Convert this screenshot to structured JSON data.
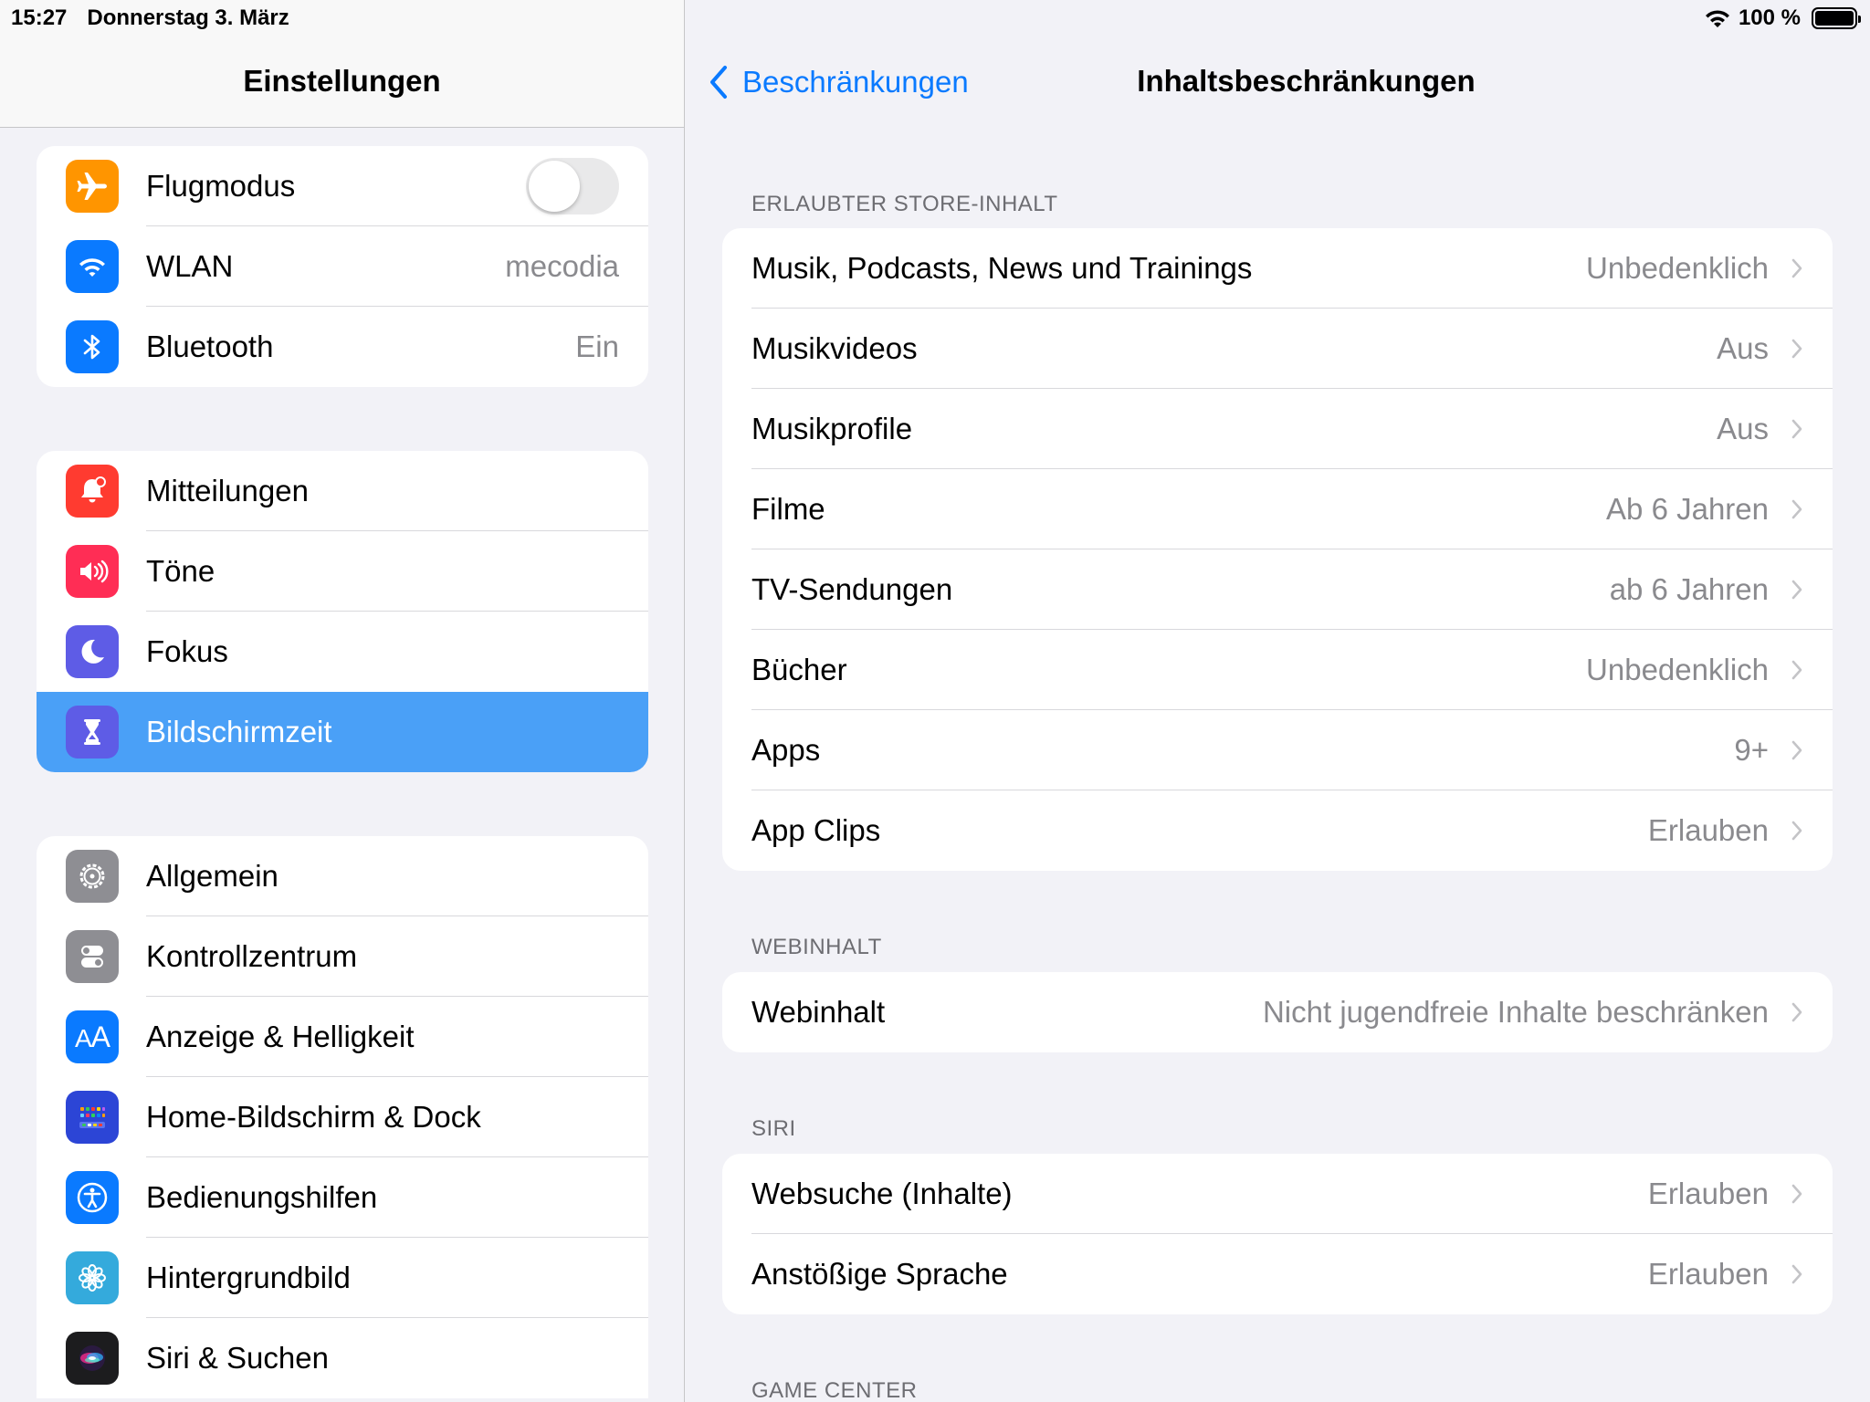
{
  "status": {
    "time": "15:27",
    "date": "Donnerstag 3. März",
    "battery": "100 %",
    "battery_level": 1.0
  },
  "sidebar": {
    "title": "Einstellungen",
    "group1": [
      {
        "label": "Flugmodus",
        "icon": "airplane-icon",
        "color": "#ff9500",
        "toggle": false
      },
      {
        "label": "WLAN",
        "value": "mecodia",
        "icon": "wifi-icon",
        "color": "#0a7aff"
      },
      {
        "label": "Bluetooth",
        "value": "Ein",
        "icon": "bluetooth-icon",
        "color": "#0a7aff"
      }
    ],
    "group2": [
      {
        "label": "Mitteilungen",
        "icon": "bell-icon",
        "color": "#ff3b30"
      },
      {
        "label": "Töne",
        "icon": "speaker-icon",
        "color": "#ff2d55"
      },
      {
        "label": "Fokus",
        "icon": "moon-icon",
        "color": "#5e5ce6"
      },
      {
        "label": "Bildschirmzeit",
        "icon": "hourglass-icon",
        "color": "#5e5ce6",
        "selected": true
      }
    ],
    "group3": [
      {
        "label": "Allgemein",
        "icon": "gear-icon",
        "color": "#8e8e93"
      },
      {
        "label": "Kontrollzentrum",
        "icon": "switches-icon",
        "color": "#8e8e93"
      },
      {
        "label": "Anzeige & Helligkeit",
        "icon": "text-size-icon",
        "color": "#0a7aff"
      },
      {
        "label": "Home-Bildschirm & Dock",
        "icon": "home-grid-icon",
        "color": "#2c45d6"
      },
      {
        "label": "Bedienungshilfen",
        "icon": "accessibility-icon",
        "color": "#0a7aff"
      },
      {
        "label": "Hintergrundbild",
        "icon": "flower-icon",
        "color": "#34aadc"
      },
      {
        "label": "Siri & Suchen",
        "icon": "siri-icon",
        "color": "#1c1c1e"
      }
    ]
  },
  "detail": {
    "back_label": "Beschränkungen",
    "title": "Inhaltsbeschränkungen",
    "sections": [
      {
        "header": "ERLAUBTER STORE-INHALT",
        "rows": [
          {
            "label": "Musik, Podcasts, News und Trainings",
            "value": "Unbedenklich"
          },
          {
            "label": "Musikvideos",
            "value": "Aus"
          },
          {
            "label": "Musikprofile",
            "value": "Aus"
          },
          {
            "label": "Filme",
            "value": "Ab 6 Jahren"
          },
          {
            "label": "TV-Sendungen",
            "value": "ab 6 Jahren"
          },
          {
            "label": "Bücher",
            "value": "Unbedenklich"
          },
          {
            "label": "Apps",
            "value": "9+"
          },
          {
            "label": "App Clips",
            "value": "Erlauben"
          }
        ]
      },
      {
        "header": "WEBINHALT",
        "rows": [
          {
            "label": "Webinhalt",
            "value": "Nicht jugendfreie Inhalte beschränken"
          }
        ]
      },
      {
        "header": "SIRI",
        "rows": [
          {
            "label": "Websuche (Inhalte)",
            "value": "Erlauben"
          },
          {
            "label": "Anstößige Sprache",
            "value": "Erlauben"
          }
        ]
      },
      {
        "header": "GAME CENTER",
        "rows": []
      }
    ]
  }
}
